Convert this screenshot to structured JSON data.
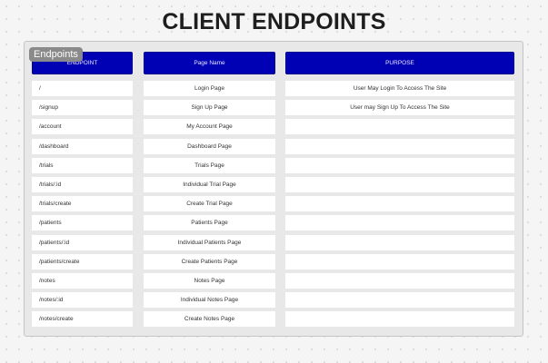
{
  "title": "CLIENT ENDPOINTS",
  "frame_label": "Endpoints",
  "headers": {
    "endpoint": "ENDPOINT",
    "page_name": "Page Name",
    "purpose": "PURPOSE"
  },
  "rows": [
    {
      "endpoint": "/",
      "page": "Login Page",
      "purpose": "User May Login To Access The Site"
    },
    {
      "endpoint": "/signup",
      "page": "Sign Up Page",
      "purpose": "User may Sign Up To Access The Site"
    },
    {
      "endpoint": "/account",
      "page": "My Account Page",
      "purpose": ""
    },
    {
      "endpoint": "/dashboard",
      "page": "Dashboard Page",
      "purpose": ""
    },
    {
      "endpoint": "/trials",
      "page": "Trials Page",
      "purpose": ""
    },
    {
      "endpoint": "/trials/:id",
      "page": "Individual Trial Page",
      "purpose": ""
    },
    {
      "endpoint": "/trials/create",
      "page": "Create Trial Page",
      "purpose": ""
    },
    {
      "endpoint": "/patients",
      "page": "Patients Page",
      "purpose": ""
    },
    {
      "endpoint": "/patients/:id",
      "page": "Individual Patients Page",
      "purpose": ""
    },
    {
      "endpoint": "/patients/create",
      "page": "Create Patients Page",
      "purpose": ""
    },
    {
      "endpoint": "/notes",
      "page": "Notes Page",
      "purpose": ""
    },
    {
      "endpoint": "/notes/:id",
      "page": "Individual Notes Page",
      "purpose": ""
    },
    {
      "endpoint": "/notes/create",
      "page": "Create Notes Page",
      "purpose": ""
    }
  ],
  "colors": {
    "header_fill": "#0000b5",
    "frame_label_bg": "#8a8a8a"
  }
}
